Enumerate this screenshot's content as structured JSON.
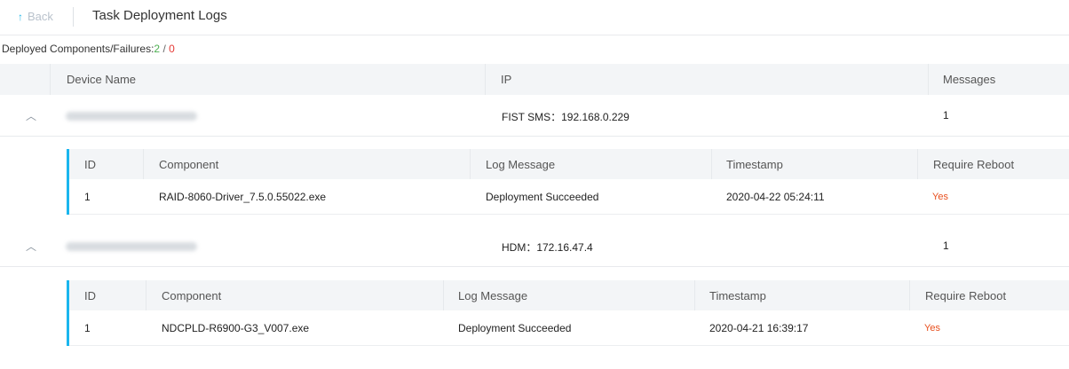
{
  "header": {
    "back_label": "Back",
    "back_arrow": "↑",
    "title": "Task Deployment Logs"
  },
  "summary": {
    "label": "Deployed Components/Failures:",
    "deployed": "2",
    "separator": " / ",
    "failures": "0",
    "colors": {
      "deployed": "#4caf50",
      "failures": "#e53935"
    }
  },
  "table": {
    "columns": {
      "device_name": "Device Name",
      "ip": "IP",
      "messages": "Messages"
    },
    "devices": [
      {
        "ip": "FIST SMS：192.168.0.229",
        "messages": "1",
        "expanded_icon": "chevron-up-icon",
        "logs": {
          "columns": {
            "id": "ID",
            "component": "Component",
            "log_message": "Log Message",
            "timestamp": "Timestamp",
            "require_reboot": "Require Reboot"
          },
          "rows": [
            {
              "id": "1",
              "component": "RAID-8060-Driver_7.5.0.55022.exe",
              "log_message": "Deployment Succeeded",
              "timestamp": "2020-04-22 05:24:11",
              "require_reboot": "Yes"
            }
          ]
        }
      },
      {
        "ip": "HDM：172.16.47.4",
        "messages": "1",
        "expanded_icon": "chevron-up-icon",
        "logs": {
          "columns": {
            "id": "ID",
            "component": "Component",
            "log_message": "Log Message",
            "timestamp": "Timestamp",
            "require_reboot": "Require Reboot"
          },
          "rows": [
            {
              "id": "1",
              "component": "NDCPLD-R6900-G3_V007.exe",
              "log_message": "Deployment Succeeded",
              "timestamp": "2020-04-21 16:39:17",
              "require_reboot": "Yes"
            }
          ]
        }
      }
    ]
  },
  "colors": {
    "accent": "#1ab6ee",
    "reboot_yes": "#e8501f"
  }
}
